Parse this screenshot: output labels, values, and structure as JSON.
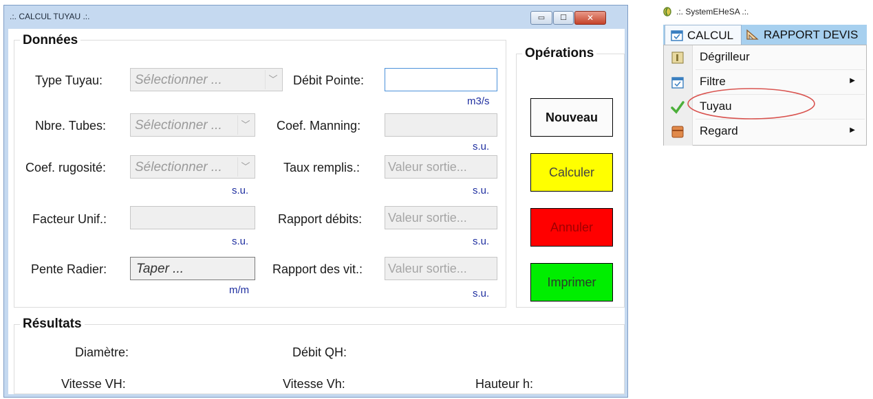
{
  "window": {
    "title": ".:. CALCUL TUYAU .:.",
    "controls": {
      "minimize": "▭",
      "maximize": "☐",
      "close": "✕"
    }
  },
  "donnees": {
    "legend": "Données",
    "type_tuyau": {
      "label": "Type Tuyau:",
      "value": "Sélectionner ..."
    },
    "nbre_tubes": {
      "label": "Nbre. Tubes:",
      "value": "Sélectionner ..."
    },
    "coef_rugosite": {
      "label": "Coef. rugosité:",
      "value": "Sélectionner ...",
      "unit": "s.u."
    },
    "facteur_unif": {
      "label": "Facteur Unif.:",
      "value": "",
      "unit": "s.u."
    },
    "pente_radier": {
      "label": "Pente Radier:",
      "value": "Taper ...",
      "unit": "m/m"
    },
    "debit_pointe": {
      "label": "Débit Pointe:",
      "value": "",
      "unit": "m3/s"
    },
    "coef_manning": {
      "label": "Coef. Manning:",
      "value": "",
      "unit": "s.u."
    },
    "taux_remplis": {
      "label": "Taux remplis.:",
      "value": "Valeur sortie...",
      "unit": "s.u."
    },
    "rapport_debits": {
      "label": "Rapport débits:",
      "value": "Valeur sortie...",
      "unit": "s.u."
    },
    "rapport_vit": {
      "label": "Rapport des vit.:",
      "value": "Valeur sortie...",
      "unit": "s.u."
    }
  },
  "operations": {
    "legend": "Opérations",
    "nouveau": "Nouveau",
    "calculer": "Calculer",
    "annuler": "Annuler",
    "imprimer": "Imprimer"
  },
  "resultats": {
    "legend": "Résultats",
    "diametre": "Diamètre:",
    "debit_qh": "Débit QH:",
    "vitesse_vh_upper": "Vitesse VH:",
    "vitesse_vh_lower": "Vitesse Vh:",
    "hauteur": "Hauteur h:"
  },
  "menu": {
    "app_title": ".:. SystemEHeSA .:.",
    "tabs": [
      "CALCUL",
      "RAPPORT DEVIS"
    ],
    "items": [
      {
        "label": "Dégrilleur",
        "icon": "degrilleur-icon",
        "submenu": false
      },
      {
        "label": "Filtre",
        "icon": "filtre-icon",
        "submenu": true
      },
      {
        "label": "Tuyau",
        "icon": "checkmark-icon",
        "submenu": false,
        "highlighted": true
      },
      {
        "label": "Regard",
        "icon": "regard-icon",
        "submenu": true
      }
    ]
  },
  "colors": {
    "calculer": "#ffff00",
    "annuler": "#ff0000",
    "imprimer": "#00ee00",
    "highlight_ellipse": "#d9534f",
    "menu_bar": "#a7d0ef"
  }
}
